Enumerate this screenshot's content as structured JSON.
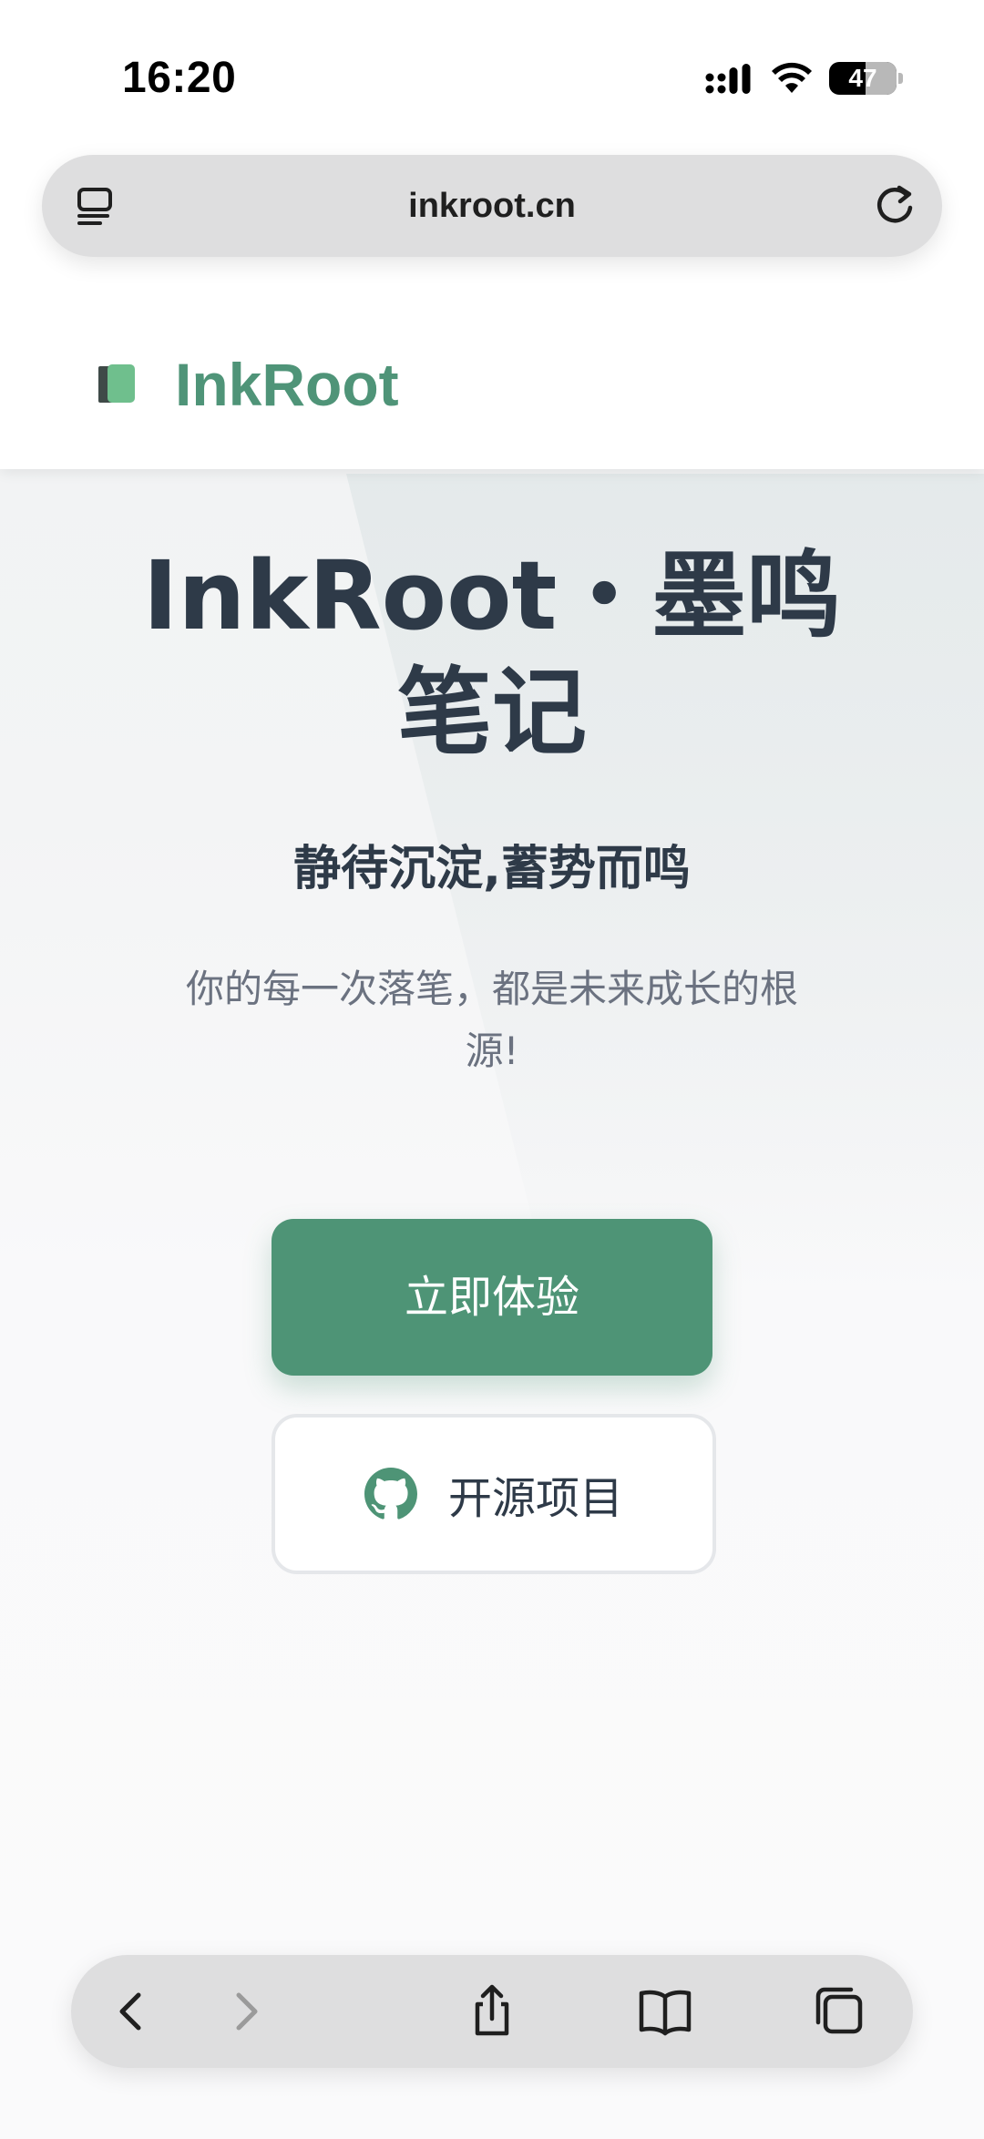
{
  "status_bar": {
    "time": "16:20",
    "battery": "47"
  },
  "browser": {
    "url": "inkroot.cn"
  },
  "site": {
    "name": "InkRoot",
    "brand_color": "#4f9478"
  },
  "hero": {
    "title": "InkRoot・墨鸣笔记",
    "subtitle": "静待沉淀,蓄势而鸣",
    "description": "你的每一次落笔，都是未来成长的根源!",
    "primary_button": "立即体验",
    "secondary_button": "开源项目",
    "secondary_button_icon": "github-icon",
    "text_color": "#2e3a48",
    "muted_color": "#6b7280"
  },
  "toolbar": {
    "icons": [
      "back-icon",
      "forward-icon",
      "share-icon",
      "bookmarks-icon",
      "tabs-icon"
    ]
  }
}
